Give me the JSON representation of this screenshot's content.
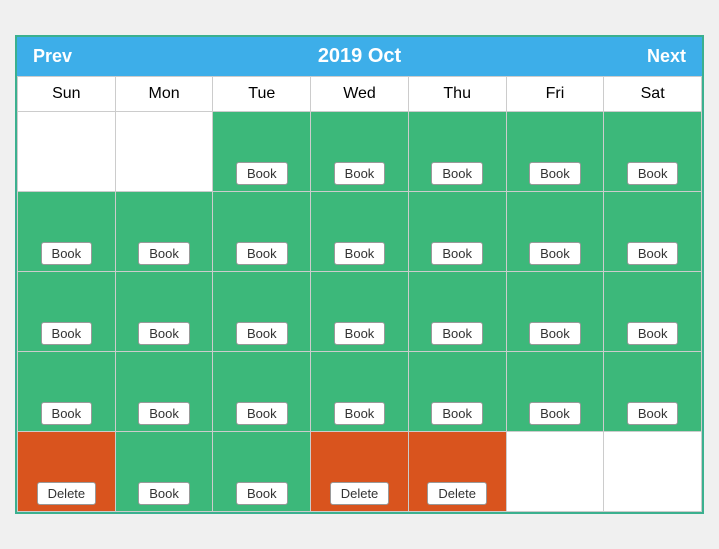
{
  "header": {
    "prev_label": "Prev",
    "title": "2019 Oct",
    "next_label": "Next"
  },
  "day_headers": [
    "Sun",
    "Mon",
    "Tue",
    "Wed",
    "Thu",
    "Fri",
    "Sat"
  ],
  "rows": [
    [
      {
        "type": "empty",
        "btn": null
      },
      {
        "type": "empty",
        "btn": null
      },
      {
        "type": "green",
        "btn": "Book"
      },
      {
        "type": "green",
        "btn": "Book"
      },
      {
        "type": "green",
        "btn": "Book"
      },
      {
        "type": "green",
        "btn": "Book"
      },
      {
        "type": "green",
        "btn": "Book"
      }
    ],
    [
      {
        "type": "green",
        "btn": "Book"
      },
      {
        "type": "green",
        "btn": "Book"
      },
      {
        "type": "green",
        "btn": "Book"
      },
      {
        "type": "green",
        "btn": "Book"
      },
      {
        "type": "green",
        "btn": "Book"
      },
      {
        "type": "green",
        "btn": "Book"
      },
      {
        "type": "green",
        "btn": "Book"
      }
    ],
    [
      {
        "type": "green",
        "btn": "Book"
      },
      {
        "type": "green",
        "btn": "Book"
      },
      {
        "type": "green",
        "btn": "Book"
      },
      {
        "type": "green",
        "btn": "Book"
      },
      {
        "type": "green",
        "btn": "Book"
      },
      {
        "type": "green",
        "btn": "Book"
      },
      {
        "type": "green",
        "btn": "Book"
      }
    ],
    [
      {
        "type": "green",
        "btn": "Book"
      },
      {
        "type": "green",
        "btn": "Book"
      },
      {
        "type": "green",
        "btn": "Book"
      },
      {
        "type": "green",
        "btn": "Book"
      },
      {
        "type": "green",
        "btn": "Book"
      },
      {
        "type": "green",
        "btn": "Book"
      },
      {
        "type": "green",
        "btn": "Book"
      }
    ],
    [
      {
        "type": "orange",
        "btn": "Delete"
      },
      {
        "type": "green",
        "btn": "Book"
      },
      {
        "type": "green",
        "btn": "Book"
      },
      {
        "type": "orange",
        "btn": "Delete"
      },
      {
        "type": "orange",
        "btn": "Delete"
      },
      {
        "type": "empty",
        "btn": null
      },
      {
        "type": "empty",
        "btn": null
      }
    ]
  ]
}
